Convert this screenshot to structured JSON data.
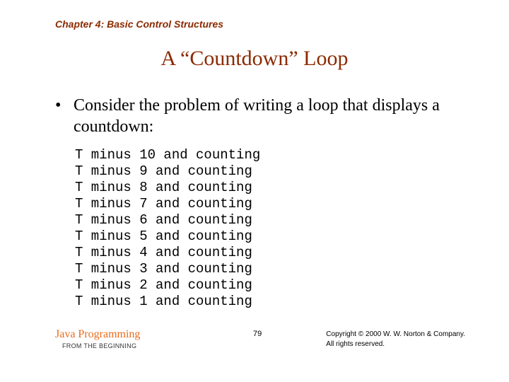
{
  "chapter": "Chapter 4: Basic Control Structures",
  "title": "A “Countdown” Loop",
  "bullet": "Consider the problem of writing a loop that displays a countdown:",
  "code_lines": [
    "T minus 10 and counting",
    "T minus 9 and counting",
    "T minus 8 and counting",
    "T minus 7 and counting",
    "T minus 6 and counting",
    "T minus 5 and counting",
    "T minus 4 and counting",
    "T minus 3 and counting",
    "T minus 2 and counting",
    "T minus 1 and counting"
  ],
  "footer": {
    "brand_main": "Java Programming",
    "brand_sub": "FROM THE BEGINNING",
    "page": "79",
    "copyright_line1": "Copyright © 2000 W. W. Norton & Company.",
    "copyright_line2": "All rights reserved."
  }
}
